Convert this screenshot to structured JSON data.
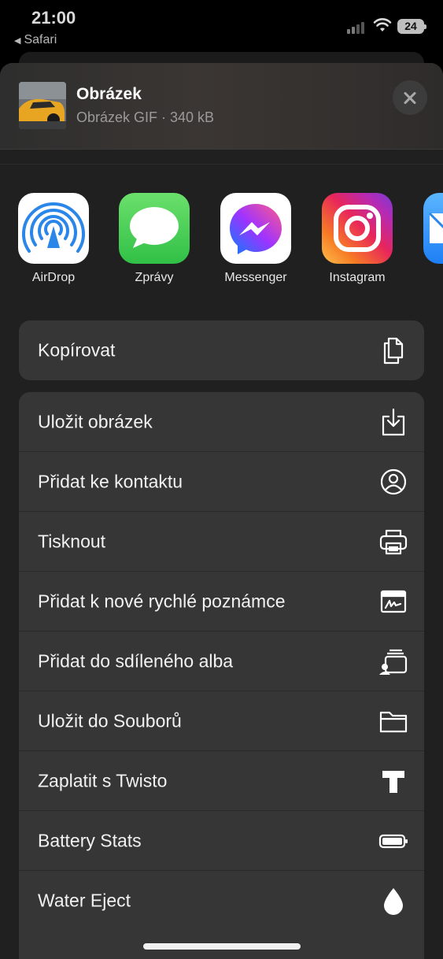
{
  "status_bar": {
    "time": "21:00",
    "back_app": "Safari",
    "battery": "24"
  },
  "share_sheet": {
    "title": "Obrázek",
    "subtitle": "Obrázek GIF · 340 kB",
    "apps": [
      {
        "label": "AirDrop",
        "icon": "airdrop-icon"
      },
      {
        "label": "Zprávy",
        "icon": "messages-icon"
      },
      {
        "label": "Messenger",
        "icon": "messenger-icon"
      },
      {
        "label": "Instagram",
        "icon": "instagram-icon"
      },
      {
        "label": "",
        "icon": "mail-icon"
      }
    ],
    "group1": [
      {
        "label": "Kopírovat",
        "icon": "copy-icon"
      }
    ],
    "group2": [
      {
        "label": "Uložit obrázek",
        "icon": "save-image-icon"
      },
      {
        "label": "Přidat ke kontaktu",
        "icon": "contact-icon"
      },
      {
        "label": "Tisknout",
        "icon": "print-icon"
      },
      {
        "label": "Přidat k nové rychlé poznámce",
        "icon": "quick-note-icon"
      },
      {
        "label": "Přidat do sdíleného alba",
        "icon": "shared-album-icon"
      },
      {
        "label": "Uložit do Souborů",
        "icon": "folder-icon"
      },
      {
        "label": "Zaplatit s Twisto",
        "icon": "twisto-icon"
      },
      {
        "label": "Battery Stats",
        "icon": "battery-icon"
      },
      {
        "label": "Water Eject",
        "icon": "water-drop-icon"
      }
    ]
  },
  "colors": {
    "sheet_bg": "#202020",
    "group_bg": "#363636",
    "messages_green": "#31c046",
    "airdrop_blue": "#2a86e8"
  }
}
